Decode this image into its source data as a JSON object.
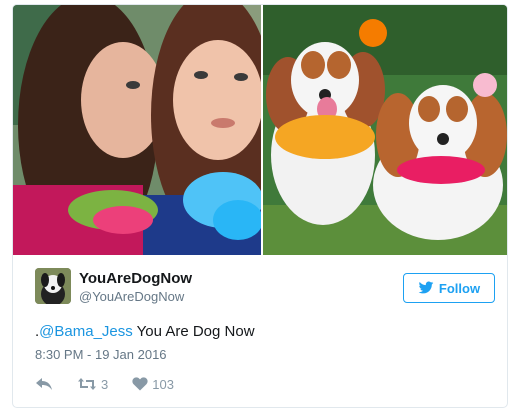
{
  "media": {
    "left_photo": "two-women-selfie",
    "right_photo": "two-cavalier-spaniels-with-leis"
  },
  "user": {
    "display_name": "YouAreDogNow",
    "handle": "@YouAreDogNow",
    "avatar_icon": "dog-avatar-icon"
  },
  "follow": {
    "label": "Follow",
    "icon": "twitter-bird-icon",
    "color": "#1da1f2"
  },
  "tweet": {
    "prefix": ".",
    "mention": "@Bama_Jess",
    "text": " You Are Dog Now",
    "timestamp": "8:30 PM - 19 Jan 2016"
  },
  "actions": {
    "reply_icon": "reply-icon",
    "retweet_icon": "retweet-icon",
    "retweet_count": "3",
    "like_icon": "heart-icon",
    "like_count": "103"
  },
  "colors": {
    "link": "#1b95e0",
    "muted": "#657786",
    "icon": "#8899a6"
  }
}
